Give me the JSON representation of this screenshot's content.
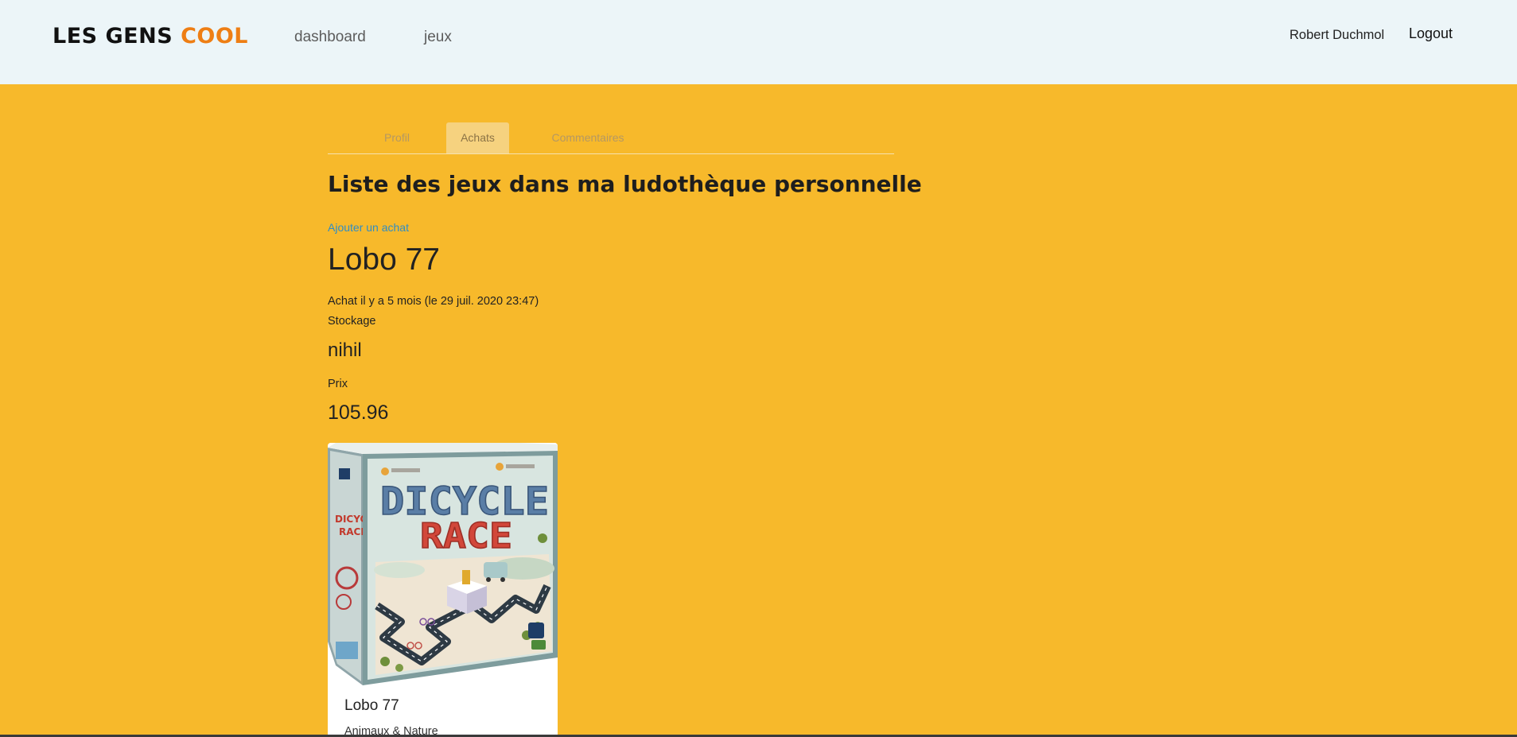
{
  "header": {
    "brand_part1": "LES GENS",
    "brand_part2": "COOL",
    "nav": [
      "dashboard",
      "jeux"
    ],
    "user_name": "Robert Duchmol",
    "logout_label": "Logout"
  },
  "tabs": [
    "Profil",
    "Achats",
    "Commentaires"
  ],
  "active_tab": "Achats",
  "main": {
    "title": "Liste des jeux dans ma ludothèque personnelle",
    "add_link": "Ajouter un achat",
    "purchase": {
      "game_title": "Lobo 77",
      "date_text": "Achat il y a 5 mois (le 29 juil. 2020 23:47)",
      "storage_label": "Stockage",
      "storage_value": "nihil",
      "price_label": "Prix",
      "price_value": "105.96"
    }
  },
  "card": {
    "box_title_line1": "DICYCLE",
    "box_title_line2": "RACE",
    "title": "Lobo 77",
    "category": "Animaux & Nature"
  },
  "colors": {
    "page_background": "#f7b92b",
    "header_background": "#ecf5f8",
    "brand_accent": "#ee7e14",
    "link": "#2f8dc4",
    "active_tab": "#f6d27f"
  }
}
